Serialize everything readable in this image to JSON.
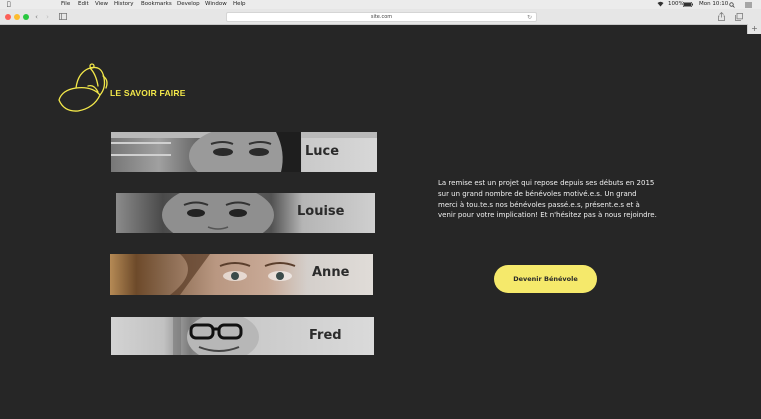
{
  "menubar": {
    "items": [
      "File",
      "Edit",
      "View",
      "History",
      "Bookmarks",
      "Develop",
      "Window",
      "Help"
    ],
    "battery": "100%",
    "clock": "Mon 10:10"
  },
  "browser": {
    "url": "site.com"
  },
  "brand": {
    "name": "LE SAVOIR FAIRE",
    "icon": "cap-icon",
    "color": "#f3e84a"
  },
  "volunteers": [
    {
      "name": "Luce"
    },
    {
      "name": "Louise"
    },
    {
      "name": "Anne"
    },
    {
      "name": "Fred"
    }
  ],
  "intro": {
    "text": "La remise est un projet qui repose depuis ses débuts en 2015 sur un grand nombre de bénévoles motivé.e.s. Un grand merci à tou.te.s nos bénévoles passé.e.s, présent.e.s et à venir pour votre implication! Et n'hésitez pas à nous rejoindre."
  },
  "cta": {
    "label": "Devenir Bénévole",
    "color": "#f5e96b"
  }
}
